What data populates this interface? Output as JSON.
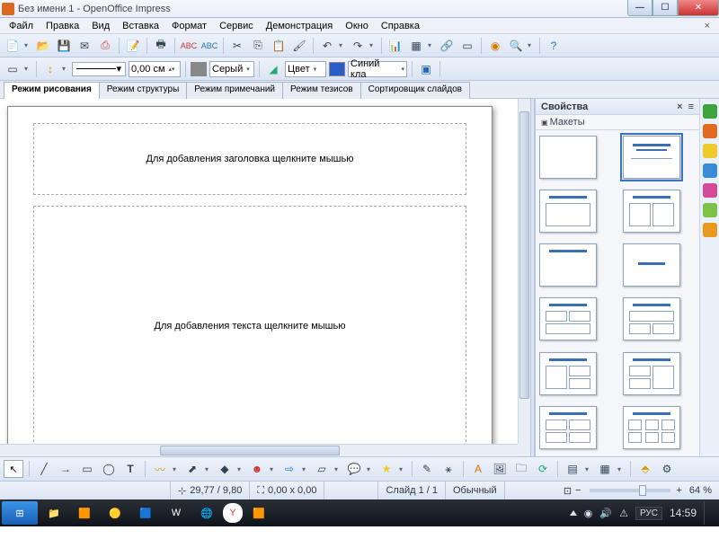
{
  "window": {
    "title": "Без имени 1 - OpenOffice Impress"
  },
  "menu": {
    "items": [
      "Файл",
      "Правка",
      "Вид",
      "Вставка",
      "Формат",
      "Сервис",
      "Демонстрация",
      "Окно",
      "Справка"
    ]
  },
  "toolbar2": {
    "width_value": "0,00 см",
    "color_name": "Серый",
    "fill_label": "Цвет",
    "fill_color": "Синий кла"
  },
  "tabs": {
    "items": [
      "Режим рисования",
      "Режим структуры",
      "Режим примечаний",
      "Режим тезисов",
      "Сортировщик слайдов"
    ],
    "active": 0
  },
  "slide": {
    "title_placeholder": "Для добавления заголовка щелкните мышью",
    "body_placeholder": "Для добавления текста щелкните мышью"
  },
  "sidepanel": {
    "header": "Свойства",
    "section": "Макеты"
  },
  "status": {
    "coords": "29,77 / 9,80",
    "size": "0,00 x 0,00",
    "slide": "Слайд 1 / 1",
    "layout": "Обычный",
    "zoom": "64 %"
  },
  "taskbar": {
    "lang": "РУС",
    "time": "14:59"
  }
}
